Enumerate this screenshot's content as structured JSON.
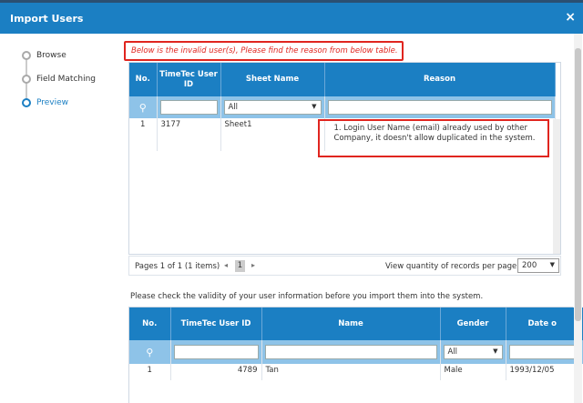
{
  "dialog": {
    "title": "Import Users",
    "close_icon": "×"
  },
  "steps": [
    {
      "label": "Browse",
      "active": false
    },
    {
      "label": "Field Matching",
      "active": false
    },
    {
      "label": "Preview",
      "active": true
    }
  ],
  "alert": {
    "text": "Below is the invalid user(s), Please find the reason from below table."
  },
  "invalid_table": {
    "headers": [
      "No.",
      "TimeTec User ID",
      "Sheet Name",
      "Reason"
    ],
    "filter": {
      "sheet_select": "All"
    },
    "rows": [
      {
        "no": "1",
        "user_id": "3177",
        "sheet": "Sheet1",
        "reason": "1. Login User Name (email) already used by other Company, it doesn't allow duplicated in the system."
      }
    ]
  },
  "pager": {
    "info": "Pages 1 of 1 (1 items)",
    "current_page": "1",
    "prev_icon": "◂",
    "next_icon": "▸",
    "qty_label": "View quantity of records per page",
    "qty_value": "200"
  },
  "note": "Please check the validity of your user information before you import them into the system.",
  "valid_table": {
    "headers": [
      "No.",
      "TimeTec User ID",
      "Name",
      "Gender",
      "Date o"
    ],
    "filter": {
      "gender_select": "All"
    },
    "rows": [
      {
        "no": "1",
        "user_id": "4789",
        "name": "Tan",
        "gender": "Male",
        "date": "1993/12/05"
      }
    ]
  },
  "colors": {
    "header_blue": "#1b7fc3",
    "filter_blue": "#8ec3e8",
    "alert_red": "#e0251f"
  }
}
